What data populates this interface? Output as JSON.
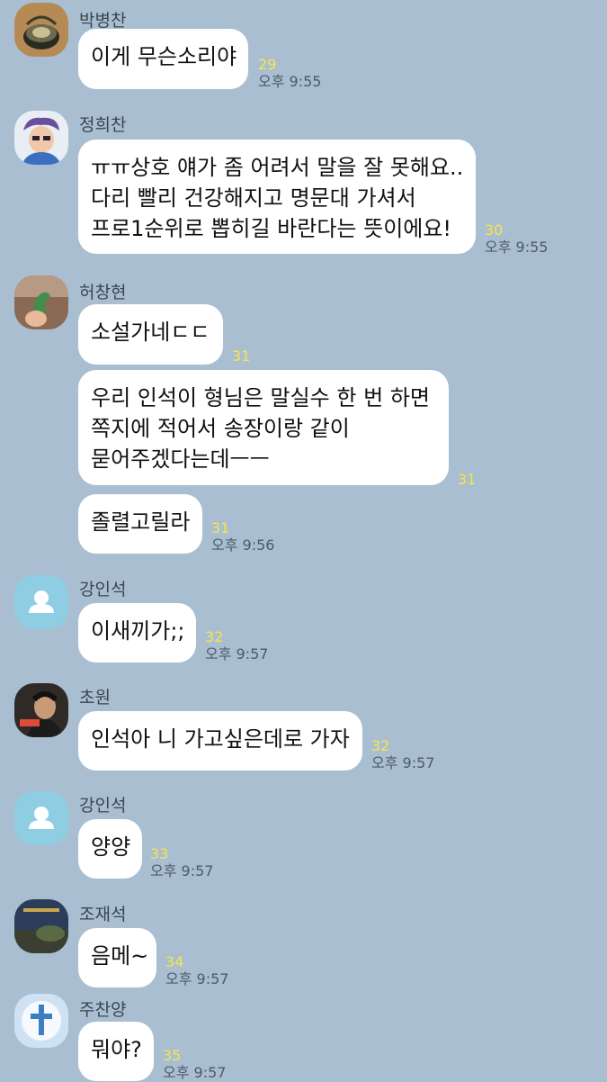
{
  "messages": [
    {
      "name": "박병찬",
      "avatar": "pot-photo",
      "bubbles": [
        {
          "lines": [
            "이게 무슨소리야"
          ],
          "unread": "29",
          "time": "오후 9:55"
        }
      ]
    },
    {
      "name": "정희찬",
      "avatar": "cartoon-photo",
      "bubbles": [
        {
          "lines": [
            "ㅠㅠ상호 얘가 좀 어려서 말을 잘 못해요..",
            "다리 빨리 건강해지고 명문대 가셔서",
            "프로1순위로 뽑히길 바란다는 뜻이에요!"
          ],
          "unread": "30",
          "time": "오후 9:55"
        }
      ]
    },
    {
      "name": "허창현",
      "avatar": "dinosaur-photo",
      "bubbles": [
        {
          "lines": [
            "소설가네ㄷㄷ"
          ],
          "unread": "31",
          "time": ""
        },
        {
          "lines": [
            "우리 인석이 형님은 말실수 한 번 하면",
            "쪽지에 적어서 송장이랑 같이",
            "묻어주겠다는데ㅡㅡ"
          ],
          "unread": "31",
          "time": ""
        },
        {
          "lines": [
            "졸렬고릴라"
          ],
          "unread": "31",
          "time": "오후 9:56"
        }
      ]
    },
    {
      "name": "강인석",
      "avatar": "default-profile",
      "bubbles": [
        {
          "lines": [
            "이새끼가;;"
          ],
          "unread": "32",
          "time": "오후 9:57"
        }
      ]
    },
    {
      "name": "초원",
      "avatar": "tv-show-photo",
      "bubbles": [
        {
          "lines": [
            "인석아 니 가고싶은데로 가자"
          ],
          "unread": "32",
          "time": "오후 9:57"
        }
      ]
    },
    {
      "name": "강인석",
      "avatar": "default-profile",
      "bubbles": [
        {
          "lines": [
            "양양"
          ],
          "unread": "33",
          "time": "오후 9:57"
        }
      ]
    },
    {
      "name": "조재석",
      "avatar": "landscape-photo",
      "bubbles": [
        {
          "lines": [
            "음메~"
          ],
          "unread": "34",
          "time": "오후 9:57"
        }
      ]
    },
    {
      "name": "주찬양",
      "avatar": "cross-photo",
      "bubbles": [
        {
          "lines": [
            "뭐야?"
          ],
          "unread": "35",
          "time": "오후 9:57"
        }
      ]
    }
  ]
}
